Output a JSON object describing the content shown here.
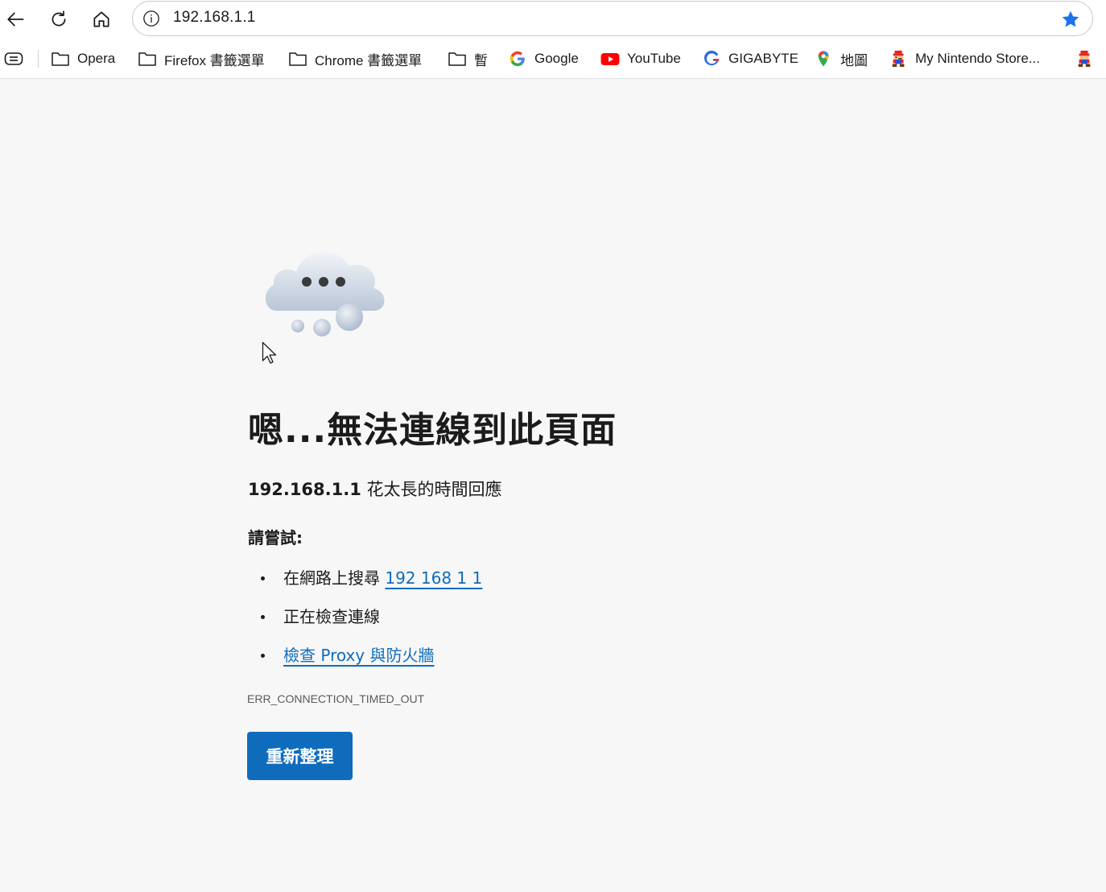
{
  "browser": {
    "address": "192.168.1.1",
    "accent_star": "#1a73e8"
  },
  "bookmarks": [
    {
      "label": "Opera",
      "icon": "folder-icon"
    },
    {
      "label": "Firefox 書籤選單",
      "icon": "folder-icon"
    },
    {
      "label": "Chrome 書籤選單",
      "icon": "folder-icon"
    },
    {
      "label": "暫",
      "icon": "folder-icon"
    },
    {
      "label": "Google",
      "icon": "google-icon"
    },
    {
      "label": "YouTube",
      "icon": "youtube-icon"
    },
    {
      "label": "GIGABYTE",
      "icon": "gigabyte-icon"
    },
    {
      "label": "地圖",
      "icon": "maps-pin-icon"
    },
    {
      "label": "My Nintendo Store...",
      "icon": "mario-icon"
    }
  ],
  "error": {
    "title": "嗯...無法連線到此頁面",
    "host": "192.168.1.1",
    "message": "花太長的時間回應",
    "try_label": "請嘗試:",
    "suggestions": [
      {
        "text": "在網路上搜尋 ",
        "link": "192 168 1 1"
      },
      {
        "text": "正在檢查連線",
        "link": ""
      },
      {
        "text": "",
        "link": "檢查 Proxy 與防火牆"
      }
    ],
    "code": "ERR_CONNECTION_TIMED_OUT",
    "refresh_label": "重新整理"
  },
  "colors": {
    "link": "#0f6cbd",
    "button": "#0f6cbd",
    "background": "#f7f7f7"
  }
}
